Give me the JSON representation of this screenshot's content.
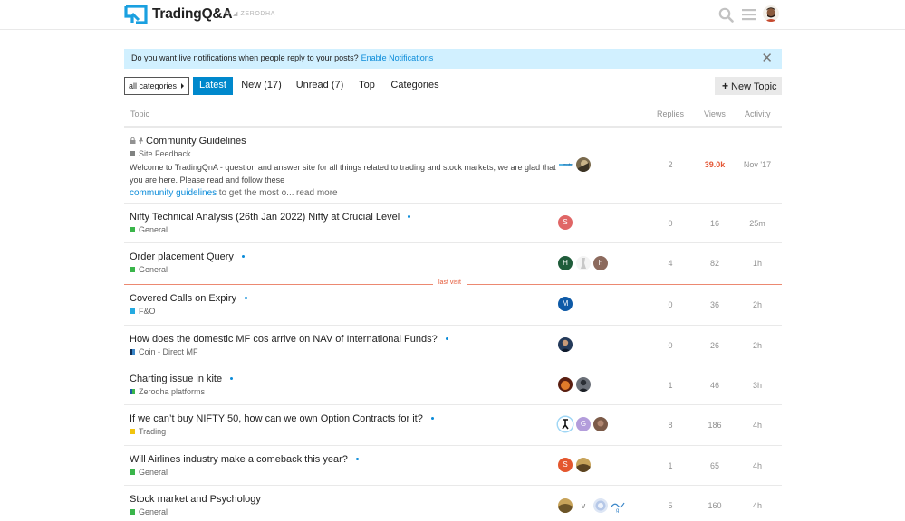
{
  "header": {
    "site_name": "TradingQ&A",
    "by_text": "by",
    "parent_brand": "ZERODHA"
  },
  "notice": {
    "text": "Do you want live notifications when people reply to your posts?",
    "link": "Enable Notifications",
    "close": "✕"
  },
  "nav": {
    "category_select": "all categories",
    "tabs": [
      "Latest",
      "New (17)",
      "Unread (7)",
      "Top",
      "Categories"
    ],
    "active_tab": "Latest",
    "new_topic": "New Topic"
  },
  "columns": {
    "topic": "Topic",
    "replies": "Replies",
    "views": "Views",
    "activity": "Activity"
  },
  "last_visit": "last visit",
  "topics": [
    {
      "title": "Community Guidelines",
      "category": "Site Feedback",
      "category_color": "#808281",
      "excerpt": "Welcome to TradingQnA - question and answer site for all things related to trading and stock markets, we are glad that you are here. Please read and follow these",
      "excerpt_link": "community guidelines",
      "excerpt_rest": "to get the most o...",
      "read_more": "read more",
      "replies": "2",
      "views": "39.0k",
      "activity": "Nov '17",
      "pinned": true,
      "locked": true,
      "unread_dot": false,
      "posters": [
        "zerodha-logo",
        "photo"
      ]
    },
    {
      "title": "Nifty Technical Analysis (26th Jan 2022) Nifty at Crucial Level",
      "category": "General",
      "category_color": "#3ab54a",
      "replies": "0",
      "views": "16",
      "activity": "25m",
      "unread_dot": true,
      "posters": [
        "S"
      ]
    },
    {
      "title": "Order placement Query",
      "category": "General",
      "category_color": "#3ab54a",
      "replies": "4",
      "views": "82",
      "activity": "1h",
      "unread_dot": true,
      "posters": [
        "H",
        "photo",
        "h"
      ]
    },
    {
      "title": "Covered Calls on Expiry",
      "category": "F&O",
      "category_color": "#25aae1",
      "replies": "0",
      "views": "36",
      "activity": "2h",
      "unread_dot": true,
      "posters": [
        "M"
      ]
    },
    {
      "title": "How does the domestic MF cos arrive on NAV of International Funds?",
      "category": "Coin - Direct MF",
      "category_color": "#0e2d55",
      "replies": "0",
      "views": "26",
      "activity": "2h",
      "unread_dot": true,
      "posters": [
        "photo"
      ]
    },
    {
      "title": "Charting issue in kite",
      "category": "Zerodha platforms",
      "category_color": "#1e5aa8",
      "replies": "1",
      "views": "46",
      "activity": "3h",
      "unread_dot": true,
      "posters": [
        "photo",
        "photo"
      ]
    },
    {
      "title": "If we can’t buy NIFTY 50, how can we own Option Contracts for it?",
      "category": "Trading",
      "category_color": "#f1c40f",
      "replies": "8",
      "views": "186",
      "activity": "4h",
      "unread_dot": true,
      "posters": [
        "photo",
        "G",
        "photo"
      ]
    },
    {
      "title": "Will Airlines industry make a comeback this year?",
      "category": "General",
      "category_color": "#3ab54a",
      "replies": "1",
      "views": "65",
      "activity": "4h",
      "unread_dot": true,
      "posters": [
        "S",
        "photo"
      ]
    },
    {
      "title": "Stock market and Psychology",
      "category": "General",
      "category_color": "#3ab54a",
      "replies": "5",
      "views": "160",
      "activity": "4h",
      "unread_dot": false,
      "posters": [
        "photo",
        "v",
        "photo",
        "photo"
      ]
    }
  ]
}
